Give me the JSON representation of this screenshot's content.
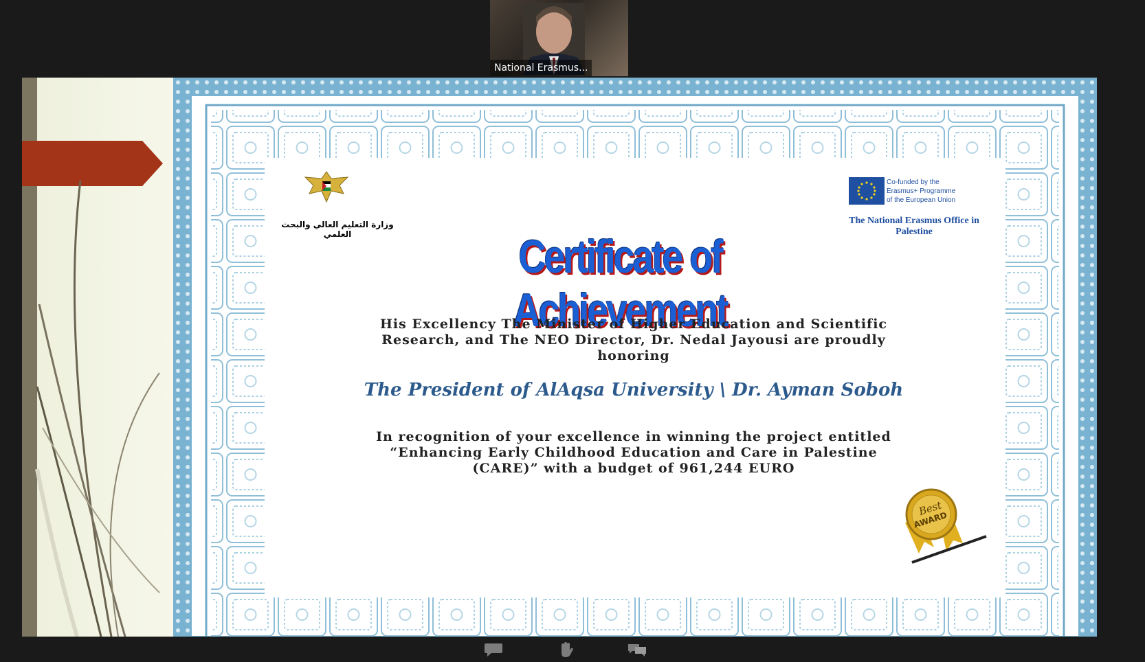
{
  "video": {
    "participant_name": "National Erasmus..."
  },
  "certificate": {
    "ministry_arabic": "وزارة التعليم العالي والبحث العلمي",
    "eu_cofunded": [
      "Co-funded by the",
      "Erasmus+ Programme",
      "of the European Union"
    ],
    "neo_name": "The National Erasmus Office in Palestine",
    "title": "Certificate of Achievement",
    "honor_lines": [
      "His Excellency The Minister of Higher Education and Scientific",
      "Research, and The NEO Director, Dr. Nedal Jayousi are proudly",
      "honoring"
    ],
    "recipient": "The President of AlAqsa University \\ Dr. Ayman Soboh",
    "recognition_lines": [
      "In recognition of your excellence in winning the project entitled",
      "“Enhancing Early Childhood Education and Care in Palestine",
      "(CARE)” with a budget of 961,244 EURO"
    ],
    "award_line1": "Best",
    "award_line2": "AWARD"
  },
  "colors": {
    "border_blue": "#6fa8c8",
    "title_blue": "#1a5fd4",
    "title_red": "#b51818",
    "slide_red": "#a33418"
  },
  "toolbar": {
    "icons": [
      "chat-icon",
      "raise-hand-icon",
      "reactions-icon"
    ]
  }
}
